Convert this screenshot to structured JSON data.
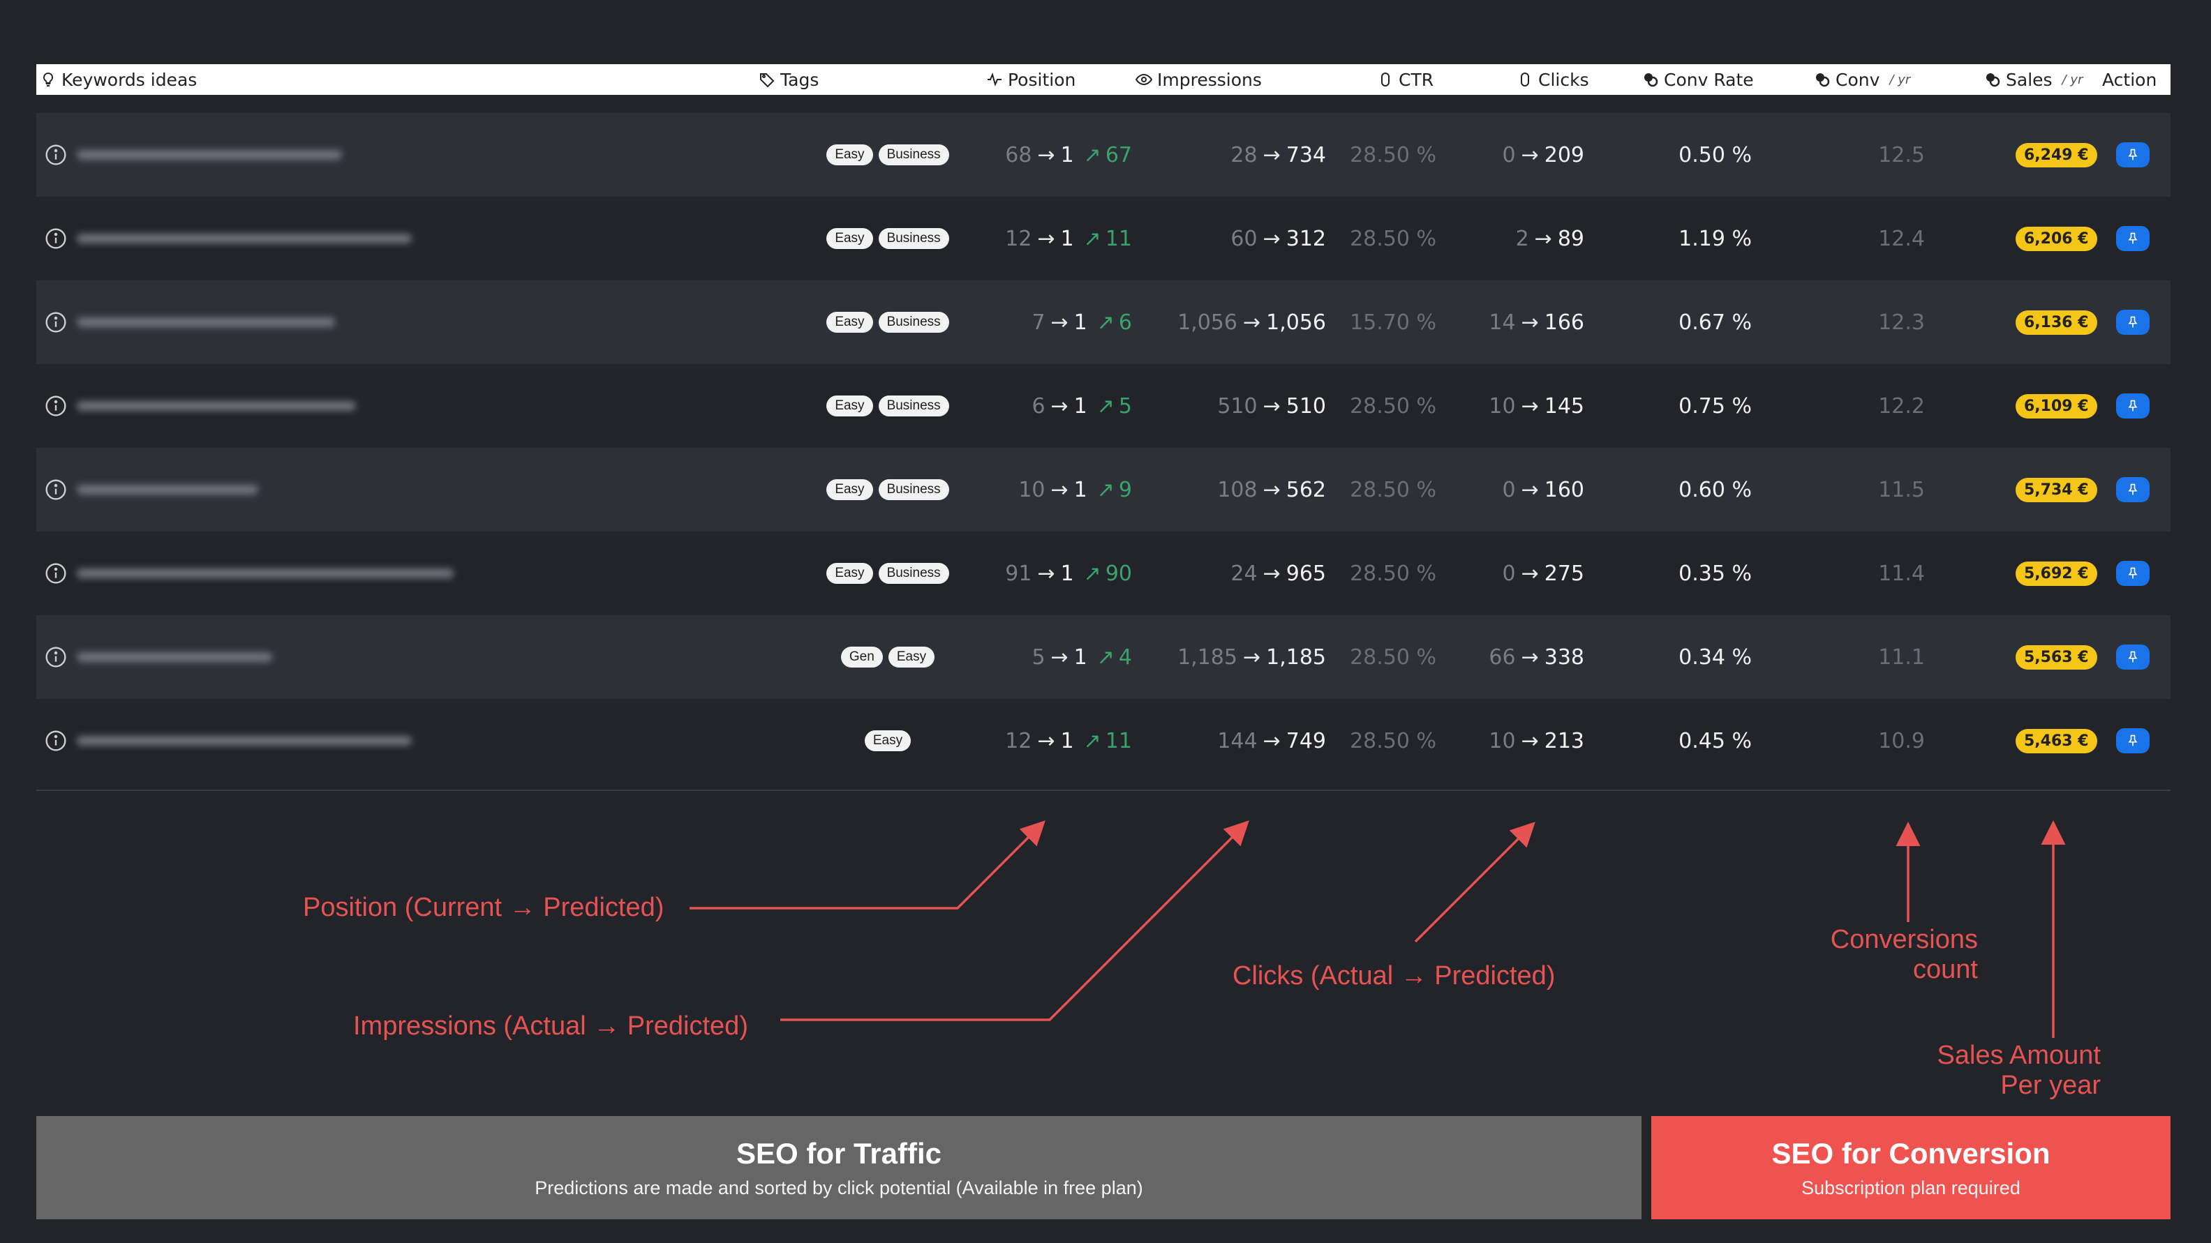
{
  "header": {
    "keywords": "Keywords ideas",
    "tags": "Tags",
    "position": "Position",
    "impressions": "Impressions",
    "ctr": "CTR",
    "clicks": "Clicks",
    "conv_rate": "Conv Rate",
    "conv": "Conv",
    "conv_unit": "/ yr",
    "sales": "Sales",
    "sales_unit": "/ yr",
    "action": "Action"
  },
  "rows": [
    {
      "tags": [
        "Easy",
        "Business"
      ],
      "pos_from": "68",
      "pos_to": "1",
      "pos_gain": "67",
      "imp_from": "28",
      "imp_to": "734",
      "ctr": "28.50 %",
      "clk_from": "0",
      "clk_to": "209",
      "conv_rate": "0.50 %",
      "conv": "12.5",
      "sales": "6,249 €"
    },
    {
      "tags": [
        "Easy",
        "Business"
      ],
      "pos_from": "12",
      "pos_to": "1",
      "pos_gain": "11",
      "imp_from": "60",
      "imp_to": "312",
      "ctr": "28.50 %",
      "clk_from": "2",
      "clk_to": "89",
      "conv_rate": "1.19 %",
      "conv": "12.4",
      "sales": "6,206 €"
    },
    {
      "tags": [
        "Easy",
        "Business"
      ],
      "pos_from": "7",
      "pos_to": "1",
      "pos_gain": "6",
      "imp_from": "1,056",
      "imp_to": "1,056",
      "ctr": "15.70 %",
      "clk_from": "14",
      "clk_to": "166",
      "conv_rate": "0.67 %",
      "conv": "12.3",
      "sales": "6,136 €"
    },
    {
      "tags": [
        "Easy",
        "Business"
      ],
      "pos_from": "6",
      "pos_to": "1",
      "pos_gain": "5",
      "imp_from": "510",
      "imp_to": "510",
      "ctr": "28.50 %",
      "clk_from": "10",
      "clk_to": "145",
      "conv_rate": "0.75 %",
      "conv": "12.2",
      "sales": "6,109 €"
    },
    {
      "tags": [
        "Easy",
        "Business"
      ],
      "pos_from": "10",
      "pos_to": "1",
      "pos_gain": "9",
      "imp_from": "108",
      "imp_to": "562",
      "ctr": "28.50 %",
      "clk_from": "0",
      "clk_to": "160",
      "conv_rate": "0.60 %",
      "conv": "11.5",
      "sales": "5,734 €"
    },
    {
      "tags": [
        "Easy",
        "Business"
      ],
      "pos_from": "91",
      "pos_to": "1",
      "pos_gain": "90",
      "imp_from": "24",
      "imp_to": "965",
      "ctr": "28.50 %",
      "clk_from": "0",
      "clk_to": "275",
      "conv_rate": "0.35 %",
      "conv": "11.4",
      "sales": "5,692 €"
    },
    {
      "tags": [
        "Gen",
        "Easy"
      ],
      "pos_from": "5",
      "pos_to": "1",
      "pos_gain": "4",
      "imp_from": "1,185",
      "imp_to": "1,185",
      "ctr": "28.50 %",
      "clk_from": "66",
      "clk_to": "338",
      "conv_rate": "0.34 %",
      "conv": "11.1",
      "sales": "5,563 €"
    },
    {
      "tags": [
        "Easy"
      ],
      "pos_from": "12",
      "pos_to": "1",
      "pos_gain": "11",
      "imp_from": "144",
      "imp_to": "749",
      "ctr": "28.50 %",
      "clk_from": "10",
      "clk_to": "213",
      "conv_rate": "0.45 %",
      "conv": "10.9",
      "sales": "5,463 €"
    }
  ],
  "annotations": {
    "position": "Position (Current → Predicted)",
    "impressions": "Impressions (Actual → Predicted)",
    "clicks": "Clicks (Actual → Predicted)",
    "conversions_line1": "Conversions",
    "conversions_line2": "count",
    "sales_line1": "Sales Amount",
    "sales_line2": "Per year"
  },
  "banners": {
    "traffic_title": "SEO for Traffic",
    "traffic_sub": "Predictions are made and sorted by click potential (Available in free plan)",
    "conversion_title": "SEO for Conversion",
    "conversion_sub": "Subscription plan required"
  },
  "colors": {
    "background": "#222429",
    "row_alt": "#2d3037",
    "annotation": "#e55353",
    "gain_green": "#3aa36b",
    "sales_badge": "#f5c518",
    "pin_button": "#1a73e8",
    "traffic_banner": "#666666",
    "conversion_banner": "#ef5350"
  },
  "icons": {
    "keywords": "lightbulb-icon",
    "tags": "tag-icon",
    "position": "pulse-icon",
    "impressions": "eye-icon",
    "ctr": "mouse-icon",
    "clicks": "mouse-icon",
    "conv_rate": "coins-icon",
    "conv": "coins-icon",
    "sales": "coins-icon",
    "row_info": "info-icon",
    "row_action": "pin-icon"
  }
}
